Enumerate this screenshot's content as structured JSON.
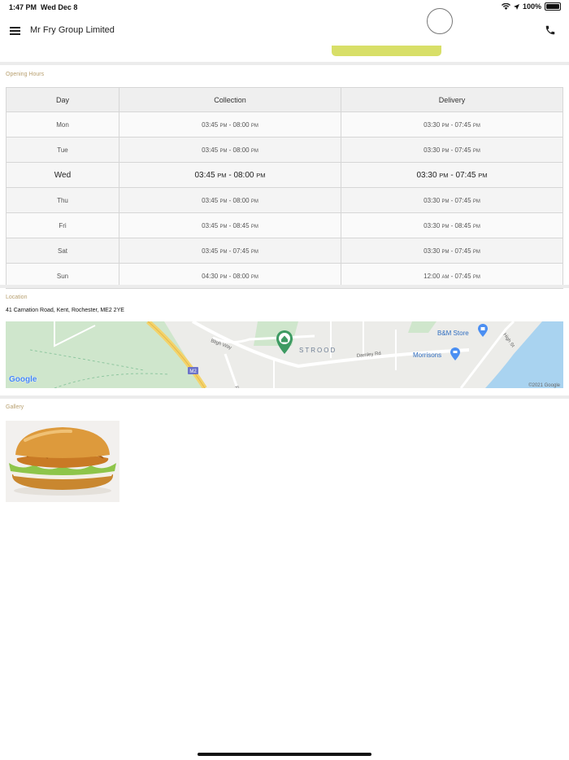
{
  "status_bar": {
    "time": "1:47 PM",
    "date": "Wed Dec 8",
    "battery": "100%"
  },
  "header": {
    "title": "Mr Fry Group Limited",
    "menu_icon": "hamburger-menu-icon",
    "phone_icon": "phone-icon"
  },
  "colors": {
    "accent": "#d8df68",
    "label": "#b8a070",
    "divider": "#ececec"
  },
  "opening_hours": {
    "label": "Opening Hours",
    "columns": [
      "Day",
      "Collection",
      "Delivery"
    ],
    "rows": [
      {
        "day": "Mon",
        "collection": {
          "open": "03:45",
          "open_ampm": "PM",
          "close": "08:00",
          "close_ampm": "PM"
        },
        "delivery": {
          "open": "03:30",
          "open_ampm": "PM",
          "close": "07:45",
          "close_ampm": "PM"
        }
      },
      {
        "day": "Tue",
        "collection": {
          "open": "03:45",
          "open_ampm": "PM",
          "close": "08:00",
          "close_ampm": "PM"
        },
        "delivery": {
          "open": "03:30",
          "open_ampm": "PM",
          "close": "07:45",
          "close_ampm": "PM"
        }
      },
      {
        "day": "Wed",
        "collection": {
          "open": "03:45",
          "open_ampm": "PM",
          "close": "08:00",
          "close_ampm": "PM"
        },
        "delivery": {
          "open": "03:30",
          "open_ampm": "PM",
          "close": "07:45",
          "close_ampm": "PM"
        }
      },
      {
        "day": "Thu",
        "collection": {
          "open": "03:45",
          "open_ampm": "PM",
          "close": "08:00",
          "close_ampm": "PM"
        },
        "delivery": {
          "open": "03:30",
          "open_ampm": "PM",
          "close": "07:45",
          "close_ampm": "PM"
        }
      },
      {
        "day": "Fri",
        "collection": {
          "open": "03:45",
          "open_ampm": "PM",
          "close": "08:45",
          "close_ampm": "PM"
        },
        "delivery": {
          "open": "03:30",
          "open_ampm": "PM",
          "close": "08:45",
          "close_ampm": "PM"
        }
      },
      {
        "day": "Sat",
        "collection": {
          "open": "03:45",
          "open_ampm": "PM",
          "close": "07:45",
          "close_ampm": "PM"
        },
        "delivery": {
          "open": "03:30",
          "open_ampm": "PM",
          "close": "07:45",
          "close_ampm": "PM"
        }
      },
      {
        "day": "Sun",
        "collection": {
          "open": "04:30",
          "open_ampm": "PM",
          "close": "08:00",
          "close_ampm": "PM"
        },
        "delivery": {
          "open": "12:00",
          "open_ampm": "AM",
          "close": "07:45",
          "close_ampm": "PM"
        }
      }
    ]
  },
  "location": {
    "label": "Location",
    "address": "41 Carnation Road, Kent, Rochester, ME2 2YE",
    "map": {
      "labels": {
        "area": "STROOD",
        "road1": "Bligh Way",
        "road2": "Darnley Rd",
        "road3": "High St",
        "road4": "Rd",
        "motorway": "M2",
        "poi1": "B&M Store",
        "poi2": "Morrisons"
      },
      "brand": "Google",
      "copyright": "©2021 Google"
    }
  },
  "gallery": {
    "label": "Gallery",
    "image": "chicken-burger"
  }
}
